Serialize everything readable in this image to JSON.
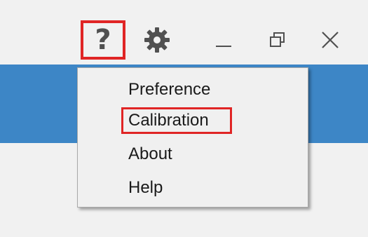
{
  "window_controls": {
    "help_glyph": "?",
    "help_icon": "question-mark-icon",
    "settings_icon": "gear-icon",
    "minimize_icon": "minimize-icon",
    "restore_icon": "restore-icon",
    "close_icon": "close-icon",
    "highlight_color": "#e02525"
  },
  "menu": {
    "items": [
      {
        "label": "Preference"
      },
      {
        "label": "Calibration",
        "highlighted": true
      },
      {
        "label": "About"
      },
      {
        "label": "Help"
      }
    ]
  },
  "colors": {
    "titlebar_bg": "#f1f1f1",
    "accent_bar": "#3d86c6",
    "menu_bg": "#f0f0f0",
    "icon_color": "#505050"
  }
}
